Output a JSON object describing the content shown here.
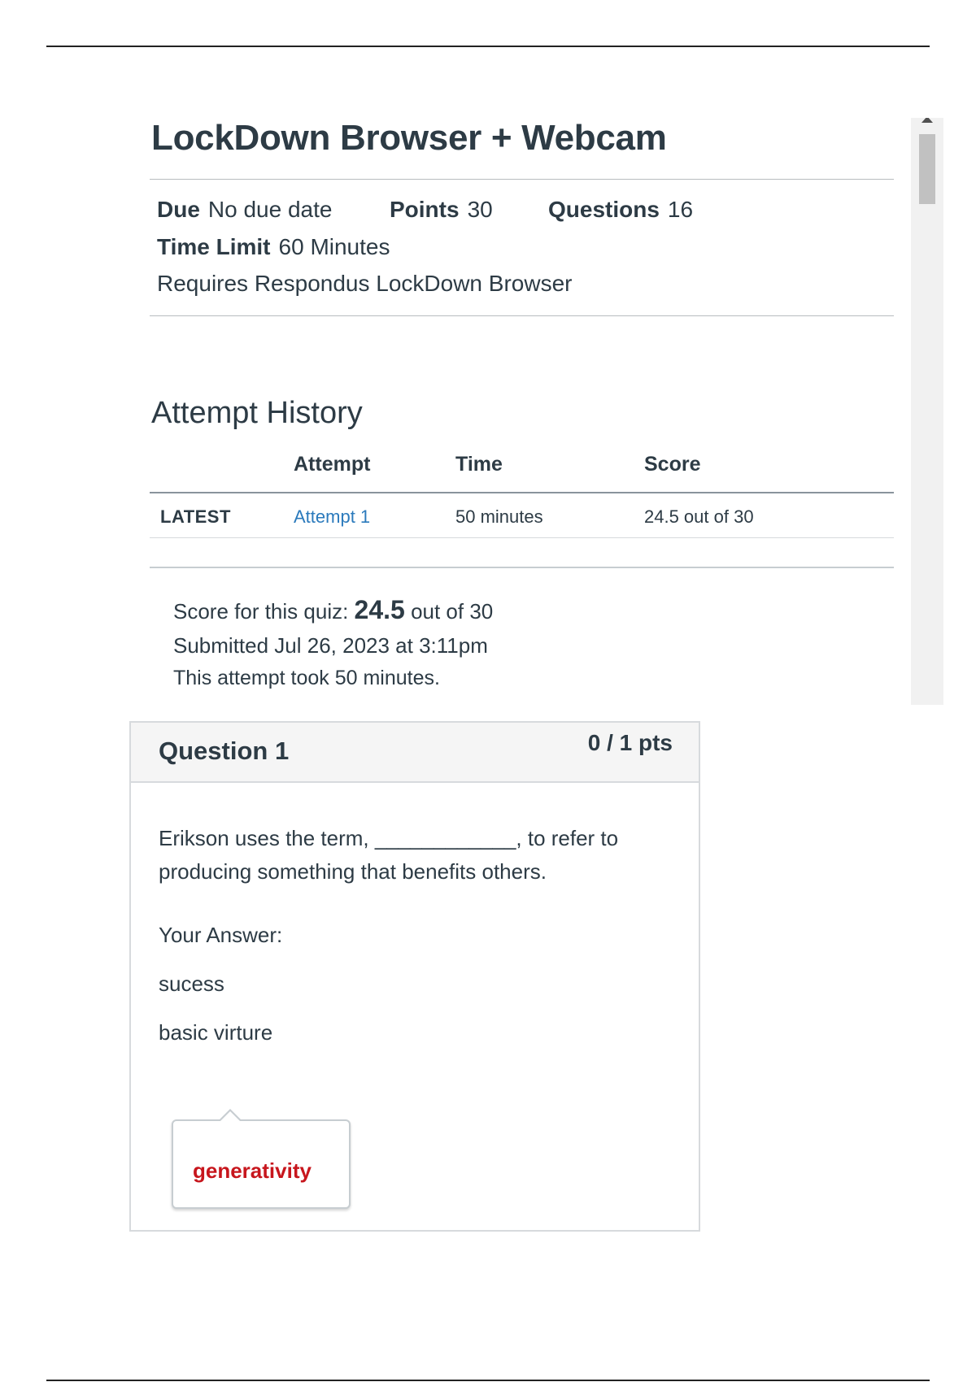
{
  "quiz": {
    "title": "LockDown Browser + Webcam",
    "due_label": "Due",
    "due_value": "No due date",
    "points_label": "Points",
    "points_value": "30",
    "questions_label": "Questions",
    "questions_value": "16",
    "time_limit_label": "Time Limit",
    "time_limit_value": "60 Minutes",
    "requirement": "Requires Respondus LockDown Browser"
  },
  "attempt_history": {
    "heading": "Attempt History",
    "columns": [
      "Attempt",
      "Time",
      "Score"
    ],
    "rows": [
      {
        "tag": "LATEST",
        "attempt": "Attempt 1",
        "time": "50 minutes",
        "score": "24.5 out of 30"
      }
    ]
  },
  "summary": {
    "score_prefix": "Score for this quiz:",
    "score_value": "24.5",
    "score_suffix": "out of 30",
    "submitted": "Submitted Jul 26, 2023 at 3:11pm",
    "duration": "This attempt took 50 minutes."
  },
  "question": {
    "title": "Question 1",
    "points": "0 / 1 pts",
    "text": "Erikson uses the term, ____________, to refer to producing something that benefits others.",
    "your_answer_label": "Your Answer:",
    "answers": [
      "sucess",
      "basic virture"
    ],
    "correct_answer": "generativity"
  },
  "colors": {
    "link": "#2b7abc",
    "correct_answer": "#c7161d",
    "text": "#2d3b45"
  }
}
